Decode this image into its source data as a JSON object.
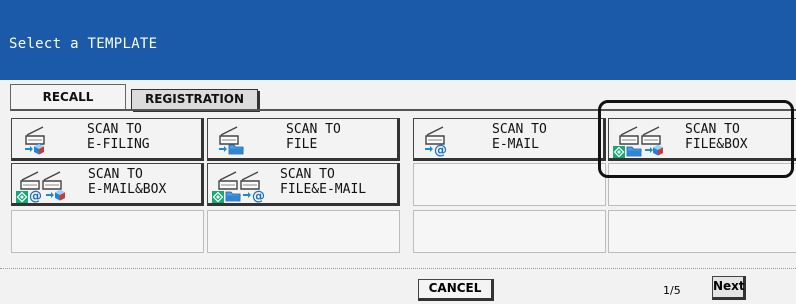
{
  "header": {
    "title": "Select a TEMPLATE"
  },
  "tabs": [
    {
      "label": "RECALL",
      "active": true
    },
    {
      "label": "REGISTRATION",
      "active": false
    }
  ],
  "templates": [
    {
      "line1": "SCAN TO",
      "line2": "E-FILING",
      "icons": [
        "scanner-icon",
        "efiling-icon"
      ]
    },
    {
      "line1": "SCAN TO",
      "line2": "FILE",
      "icons": [
        "scanner-icon",
        "folder-icon"
      ]
    },
    {
      "line1": "SCAN TO",
      "line2": "E-MAIL",
      "icons": [
        "scanner-icon",
        "email-icon"
      ]
    },
    {
      "line1": "SCAN TO",
      "line2": "FILE&BOX",
      "selected": true,
      "icons": [
        "scanner-icon",
        "scanner-icon",
        "folder-icon",
        "efiling-icon",
        "multi-agent-icon"
      ]
    },
    {
      "line1": "SCAN TO",
      "line2": "E-MAIL&BOX",
      "icons": [
        "scanner-icon",
        "scanner-icon",
        "email-icon",
        "efiling-icon",
        "multi-agent-icon"
      ]
    },
    {
      "line1": "SCAN TO",
      "line2": "FILE&E-MAIL",
      "icons": [
        "scanner-icon",
        "scanner-icon",
        "folder-icon",
        "email-icon",
        "multi-agent-icon"
      ]
    }
  ],
  "footer": {
    "cancel_label": "CANCEL",
    "page_indicator": "1/5",
    "next_label": "Next"
  },
  "colors": {
    "header": "#1a5aa8",
    "background": "#f2f2f2",
    "selection": "#111111"
  }
}
